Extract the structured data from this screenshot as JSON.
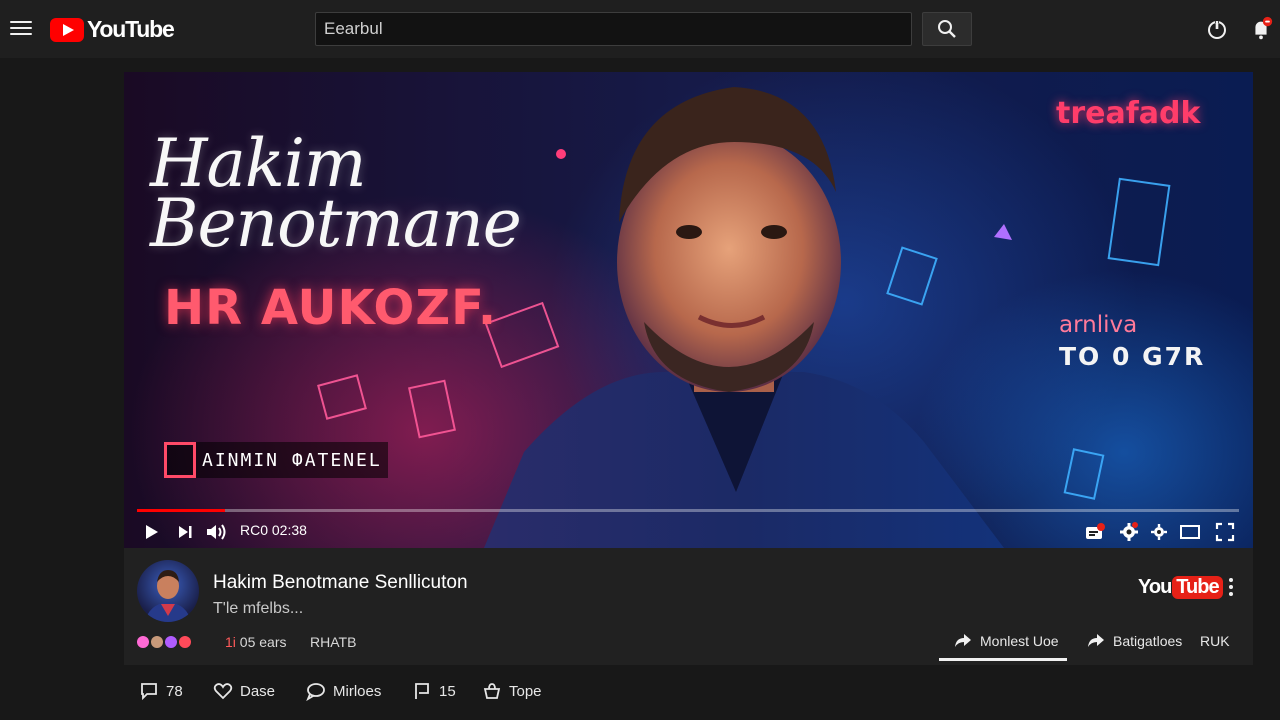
{
  "header": {
    "logo_text": "YouTube",
    "search_value": "Eearbul"
  },
  "player": {
    "thumbnail": {
      "title_line1": "Hakim",
      "title_line2": "Benotmane",
      "subtitle": "HR AUKOZF.",
      "brand": "treafadk",
      "side_line1": "arnliva",
      "side_line2": "TO 0 G7R",
      "channel_banner": "AINMIN ФATENEL"
    },
    "time_display": "RC0 02:38",
    "progress": 0.08,
    "colors": {
      "progress": "#ff0000"
    }
  },
  "video": {
    "title": "Hakim Benotmane Senllicuton",
    "description": "T'le mfelbs...",
    "badge_you": "You",
    "badge_tube": "Tube",
    "views_highlight": "1i",
    "views_rest": "05 ears",
    "code": "RHATB",
    "actions": {
      "share_label": "Monlest Uoe",
      "save_label": "Batigatloes",
      "extra_label": "RUK"
    }
  },
  "bottom_actions": [
    {
      "icon": "comment-icon",
      "label": "78"
    },
    {
      "icon": "heart-icon",
      "label": "Dase"
    },
    {
      "icon": "chat-icon",
      "label": "Mirloes"
    },
    {
      "icon": "flag-icon",
      "label": "15"
    },
    {
      "icon": "bag-icon",
      "label": "Tope"
    }
  ]
}
